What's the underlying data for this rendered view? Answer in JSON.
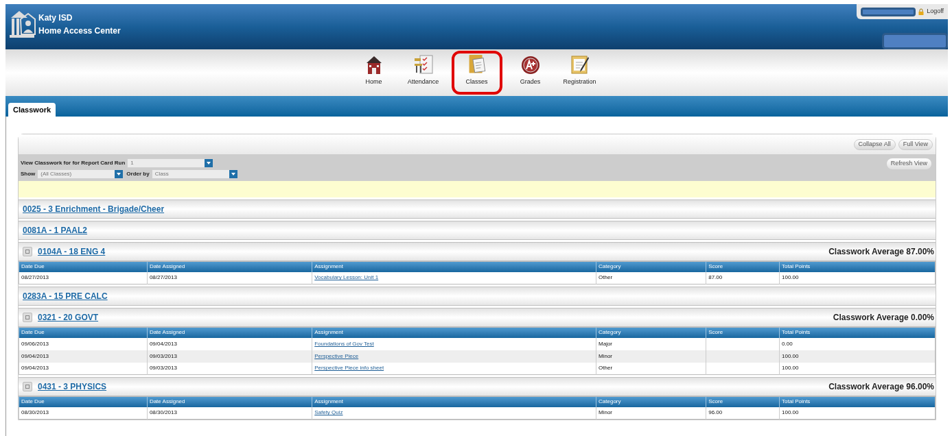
{
  "header": {
    "district": "Katy ISD",
    "app": "Home Access Center",
    "logoff": "Logoff"
  },
  "nav": [
    {
      "kind": "home",
      "label": "Home",
      "selected": false
    },
    {
      "kind": "attendance",
      "label": "Attendance",
      "selected": false
    },
    {
      "kind": "classes",
      "label": "Classes",
      "selected": true
    },
    {
      "kind": "grades",
      "label": "Grades",
      "selected": false
    },
    {
      "kind": "registration",
      "label": "Registration",
      "selected": false
    }
  ],
  "tabs": [
    {
      "label": "Classwork",
      "selected": true
    }
  ],
  "toolbar": {
    "buttons": [
      "Collapse All",
      "Full View"
    ],
    "refresh": "Refresh View"
  },
  "filters": {
    "run_label": "View Classwork for for Report Card Run",
    "run_value": "1",
    "show_label": "Show",
    "show_value": "(All Classes)",
    "order_label": "Order by",
    "order_value": "Class"
  },
  "classes": [
    {
      "name": "0025 - 3 Enrichment - Brigade/Cheer",
      "expanded": false
    },
    {
      "name": "0081A - 1 PAAL2",
      "expanded": false
    },
    {
      "name": "0104A - 18 ENG 4",
      "expanded": true,
      "average": "Classwork Average 87.00%",
      "columns": [
        "Date Due",
        "Date Assigned",
        "Assignment",
        "Category",
        "Score",
        "Total Points"
      ],
      "rows": [
        [
          "08/27/2013",
          "08/27/2013",
          "Vocabulary Lesson: Unit 1",
          "Other",
          "87.00",
          "100.00"
        ]
      ]
    },
    {
      "name": "0283A - 15 PRE CALC",
      "expanded": false
    },
    {
      "name": "0321 - 20 GOVT",
      "expanded": true,
      "average": "Classwork Average 0.00%",
      "columns": [
        "Date Due",
        "Date Assigned",
        "Assignment",
        "Category",
        "Score",
        "Total Points"
      ],
      "rows": [
        [
          "09/06/2013",
          "09/04/2013",
          "Foundations of Gov Test",
          "Major",
          "",
          "0.00"
        ],
        [
          "09/04/2013",
          "09/03/2013",
          "Perspective Piece",
          "Minor",
          "",
          "100.00"
        ],
        [
          "09/04/2013",
          "09/03/2013",
          "Perspective Piece info sheet",
          "Other",
          "",
          "100.00"
        ]
      ]
    },
    {
      "name": "0431 - 3 PHYSICS",
      "expanded": true,
      "average": "Classwork Average 96.00%",
      "columns": [
        "Date Due",
        "Date Assigned",
        "Assignment",
        "Category",
        "Score",
        "Total Points"
      ],
      "rows": [
        [
          "08/30/2013",
          "08/30/2013",
          "Safety Quiz",
          "Minor",
          "96.00",
          "100.00"
        ]
      ]
    }
  ]
}
